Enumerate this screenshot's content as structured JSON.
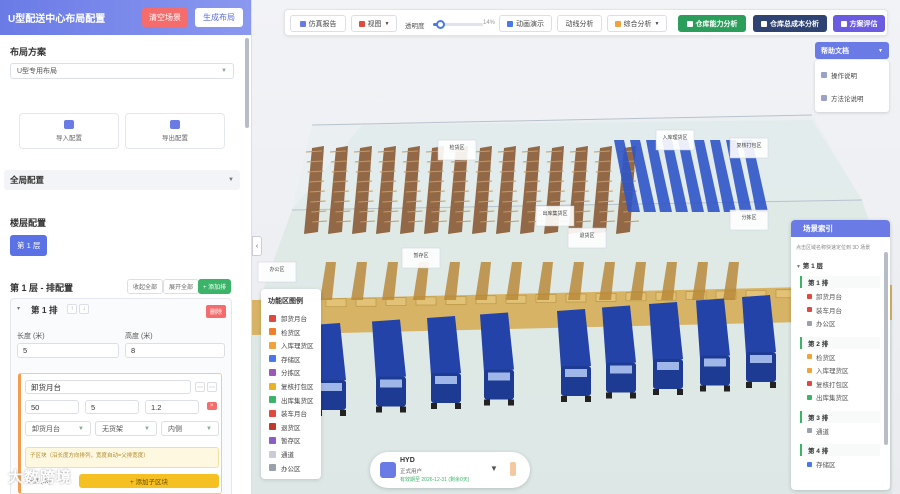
{
  "left_panel": {
    "title": "U型配送中心布局配置",
    "clear_scene": "清空场景",
    "generate_layout": "生成布局",
    "layout_scheme_title": "布局方案",
    "layout_scheme_value": "U型专用布局",
    "import_config": "导入配置",
    "export_config": "导出配置",
    "global_config": "全局配置",
    "floor_config_title": "楼层配置",
    "floor_button": "第 1 层",
    "row_config_title": "第 1 层 - 排配置",
    "collapse_all": "收起全部",
    "expand_all": "展开全部",
    "add_row": "+ 添加排",
    "row": {
      "title": "第 1 排",
      "delete": "删除",
      "length_label": "长度 (米)",
      "length_value": "5",
      "height_label": "高度 (米)",
      "height_value": "8",
      "sub_zone_name": "卸货月台",
      "sub_vals": [
        "50",
        "5",
        "1.2"
      ],
      "type_select": "卸货月台",
      "shelf_select": "无货架",
      "side_select": "内侧",
      "tip": "子区块（沿长度方向排列，宽度自动=父排宽度）",
      "add_sub_zone": "+ 添加子区块",
      "sub_label_prefix": "长度 (米)"
    }
  },
  "toolbar": {
    "sim_report": "仿真报告",
    "view": "视图",
    "opacity_label": "透明度",
    "opacity_value": "14%",
    "opacity": 0.14,
    "animation": "动画演示",
    "flow_analysis": "动线分析",
    "comprehensive": "综合分析",
    "capacity": "仓库能力分析",
    "total_cost": "仓库总成本分析",
    "scheme_eval": "方案评估"
  },
  "help": {
    "title": "帮助文档",
    "items": [
      "操作说明",
      "方法论说明"
    ]
  },
  "scene_index": {
    "title": "场景索引",
    "tip": "点击区域名称快速定位到 3D 场景",
    "floor": "第 1 层",
    "groups": [
      {
        "name": "第 1 排",
        "leaves": [
          {
            "label": "卸货月台",
            "color": "#e0493d"
          },
          {
            "label": "装车月台",
            "color": "#e0493d"
          },
          {
            "label": "办公区",
            "color": "#9aa1ad"
          }
        ]
      },
      {
        "name": "第 2 排",
        "leaves": [
          {
            "label": "检货区",
            "color": "#f2a23c"
          },
          {
            "label": "入库理货区",
            "color": "#f2a23c"
          },
          {
            "label": "复核打包区",
            "color": "#e0493d"
          },
          {
            "label": "出库集货区",
            "color": "#3bb46a"
          }
        ]
      },
      {
        "name": "第 3 排",
        "leaves": [
          {
            "label": "通道",
            "color": "#9aa1ad"
          }
        ]
      },
      {
        "name": "第 4 排",
        "leaves": [
          {
            "label": "存储区",
            "color": "#4a78e8"
          }
        ]
      }
    ]
  },
  "legend": {
    "title": "功能区图例",
    "items": [
      {
        "label": "卸货月台",
        "color": "#e0493d"
      },
      {
        "label": "检货区",
        "color": "#f07e2c"
      },
      {
        "label": "入库理货区",
        "color": "#f2a23c"
      },
      {
        "label": "存储区",
        "color": "#4a78e8"
      },
      {
        "label": "分拣区",
        "color": "#9b59b6"
      },
      {
        "label": "复核打包区",
        "color": "#e8b424"
      },
      {
        "label": "出库集货区",
        "color": "#3bb46a"
      },
      {
        "label": "装车月台",
        "color": "#e0493d"
      },
      {
        "label": "退货区",
        "color": "#c0392b"
      },
      {
        "label": "暂存区",
        "color": "#8e5cc7"
      },
      {
        "label": "通道",
        "color": "#c8ccd4"
      },
      {
        "label": "办公区",
        "color": "#9aa1ad"
      }
    ]
  },
  "scene_labels": [
    "检货区",
    "入库理货区",
    "复核打包区",
    "出库集货区",
    "退货区",
    "暂存区",
    "分拣区",
    "办公区"
  ],
  "user": {
    "name": "HYD",
    "role": "正式用户",
    "expiry": "有效期至 2026-12-31 (剩余0天)"
  },
  "watermark": "大数跨境"
}
